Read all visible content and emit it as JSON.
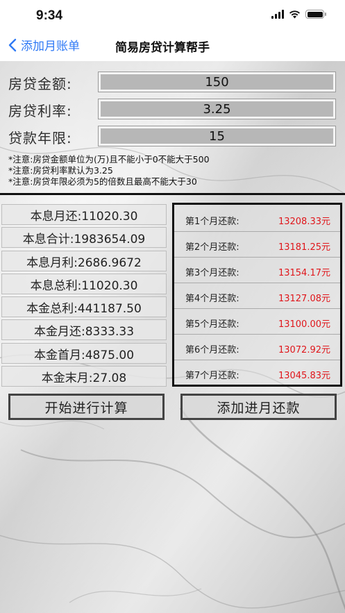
{
  "status_bar": {
    "time": "9:34"
  },
  "nav": {
    "back_label": "添加月账单",
    "title": "简易房贷计算帮手"
  },
  "inputs": [
    {
      "label": "房贷金额:",
      "value": "150"
    },
    {
      "label": "房贷利率:",
      "value": "3.25"
    },
    {
      "label": "贷款年限:",
      "value": "15"
    }
  ],
  "notes": [
    "*注意:房贷金额单位为(万)且不能小于0不能大于500",
    "*注意:房贷利率默认为3.25",
    "*注意:房贷年限必须为5的倍数且最高不能大于30"
  ],
  "results": [
    "本息月还:11020.30",
    "本息合计:1983654.09",
    "本息月利:2686.9672",
    "本息总利:11020.30",
    "本金总利:441187.50",
    "本金月还:8333.33",
    "本金首月:4875.00",
    "本金末月:27.08"
  ],
  "schedule": [
    {
      "label": "第1个月还款:",
      "amount": "13208.33元"
    },
    {
      "label": "第2个月还款:",
      "amount": "13181.25元"
    },
    {
      "label": "第3个月还款:",
      "amount": "13154.17元"
    },
    {
      "label": "第4个月还款:",
      "amount": "13127.08元"
    },
    {
      "label": "第5个月还款:",
      "amount": "13100.00元"
    },
    {
      "label": "第6个月还款:",
      "amount": "13072.92元"
    },
    {
      "label": "第7个月还款:",
      "amount": "13045.83元"
    }
  ],
  "buttons": {
    "calculate": "开始进行计算",
    "add_monthly": "添加进月还款"
  },
  "colors": {
    "accent": "#2f7af5",
    "amount_red": "#e0161b"
  }
}
